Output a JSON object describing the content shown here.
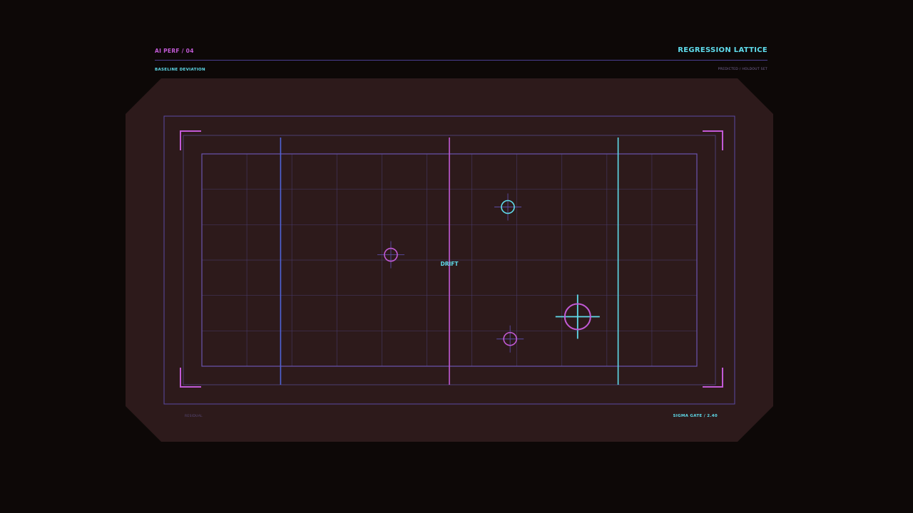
{
  "header": {
    "series_label": "AI PERF / 04",
    "title": "REGRESSION LATTICE",
    "left_subtitle": "BASELINE DEVIATION",
    "right_subtitle": "PREDICTED / HOLDOUT SET"
  },
  "footer": {
    "left_text": "RESIDUAL",
    "right_text": "SIGMA GATE / 2.40"
  },
  "colors": {
    "background": "#0d0807",
    "panel": "#2d1a1b",
    "grid": "#4a3d72",
    "frame": "#5a4ba6",
    "magenta": "#c25ad6",
    "cyan": "#5fdcec",
    "blue": "#4f63d8",
    "label": "#5fdcec"
  },
  "icons": {
    "corner_bracket": "corner-bracket-icon",
    "target_reticle": "target-reticle-icon"
  },
  "chart_data": {
    "type": "scatter",
    "title": "REGRESSION LATTICE",
    "xlabel": "",
    "ylabel": "",
    "xlim": [
      0,
      11
    ],
    "ylim": [
      0,
      6
    ],
    "grid": true,
    "gridlines": {
      "x_divisions": 11,
      "y_divisions": 6
    },
    "reference_lines": [
      {
        "x": 1.75,
        "color": "blue"
      },
      {
        "x": 5.5,
        "color": "magenta",
        "label": "DRIFT"
      },
      {
        "x": 9.25,
        "color": "cyan"
      }
    ],
    "points": [
      {
        "x": 4.2,
        "y": 3.15,
        "size": "small",
        "color": "magenta"
      },
      {
        "x": 6.8,
        "y": 4.5,
        "size": "small",
        "color": "cyan"
      },
      {
        "x": 8.35,
        "y": 1.4,
        "size": "large",
        "color": "magenta"
      },
      {
        "x": 6.85,
        "y": 0.77,
        "size": "small",
        "color": "magenta"
      }
    ]
  }
}
